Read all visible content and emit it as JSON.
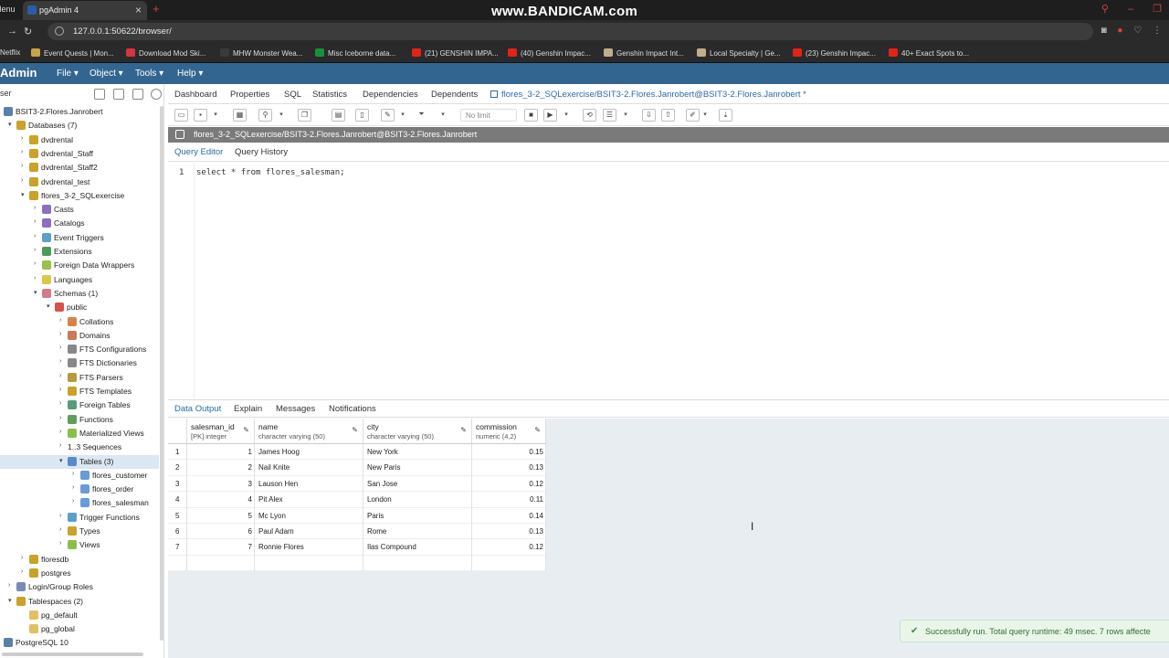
{
  "browser": {
    "menu_label": "Menu",
    "tab_title": "pgAdmin 4",
    "watermark": "www.BANDICAM.com",
    "url": "127.0.0.1:50622/browser/",
    "bookmarks": [
      {
        "label": "Netflix",
        "color": "#e50914"
      },
      {
        "label": "Event Quests | Mon...",
        "color": "#c8a44a"
      },
      {
        "label": "Download Mod Ski...",
        "color": "#d9343f"
      },
      {
        "label": "MHW Monster Wea...",
        "color": "#3a3a3a"
      },
      {
        "label": "Misc Iceborne data...",
        "color": "#1a8f3a"
      },
      {
        "label": "(21) GENSHIN IMPA...",
        "color": "#e62117"
      },
      {
        "label": "(40) Genshin Impac...",
        "color": "#e62117"
      },
      {
        "label": "Genshin Impact Int...",
        "color": "#bfae8a"
      },
      {
        "label": "Local Specialty | Ge...",
        "color": "#bfae8a"
      },
      {
        "label": "(23) Genshin Impac...",
        "color": "#e62117"
      },
      {
        "label": "40+ Exact Spots to...",
        "color": "#e62117"
      }
    ]
  },
  "pgadmin": {
    "brand": "Admin",
    "menus": [
      "File ▾",
      "Object ▾",
      "Tools ▾",
      "Help ▾"
    ]
  },
  "left_panel": {
    "title": "ser",
    "tree": [
      {
        "label": "BSIT3-2.Flores.Janrobert",
        "level": 0,
        "chev": "",
        "icon": "#5b7fa8"
      },
      {
        "label": "Databases (7)",
        "level": 1,
        "chev": "▾",
        "icon": "#c9a227"
      },
      {
        "label": "dvdrental",
        "level": 2,
        "chev": "›",
        "icon": "#c9a227"
      },
      {
        "label": "dvdrental_Staff",
        "level": 2,
        "chev": "›",
        "icon": "#c9a227"
      },
      {
        "label": "dvdrental_Staff2",
        "level": 2,
        "chev": "›",
        "icon": "#c9a227"
      },
      {
        "label": "dvdrental_test",
        "level": 2,
        "chev": "›",
        "icon": "#c9a227"
      },
      {
        "label": "flores_3-2_SQLexercise",
        "level": 2,
        "chev": "▾",
        "icon": "#c9a227"
      },
      {
        "label": "Casts",
        "level": 3,
        "chev": "›",
        "icon": "#8c6fbf"
      },
      {
        "label": "Catalogs",
        "level": 3,
        "chev": "›",
        "icon": "#8c6fbf"
      },
      {
        "label": "Event Triggers",
        "level": 3,
        "chev": "›",
        "icon": "#5aa0c8"
      },
      {
        "label": "Extensions",
        "level": 3,
        "chev": "›",
        "icon": "#4a9a5a"
      },
      {
        "label": "Foreign Data Wrappers",
        "level": 3,
        "chev": "›",
        "icon": "#9ac24a"
      },
      {
        "label": "Languages",
        "level": 3,
        "chev": "›",
        "icon": "#d9c84a"
      },
      {
        "label": "Schemas (1)",
        "level": 3,
        "chev": "▾",
        "icon": "#d47a8a"
      },
      {
        "label": "public",
        "level": 4,
        "chev": "▾",
        "icon": "#d4544a"
      },
      {
        "label": "Collations",
        "level": 5,
        "chev": "›",
        "icon": "#d4844a"
      },
      {
        "label": "Domains",
        "level": 5,
        "chev": "›",
        "icon": "#c87a5a"
      },
      {
        "label": "FTS Configurations",
        "level": 5,
        "chev": "›",
        "icon": "#888888"
      },
      {
        "label": "FTS Dictionaries",
        "level": 5,
        "chev": "›",
        "icon": "#888888"
      },
      {
        "label": "FTS Parsers",
        "level": 5,
        "chev": "›",
        "icon": "#b89a3a"
      },
      {
        "label": "FTS Templates",
        "level": 5,
        "chev": "›",
        "icon": "#c9a227"
      },
      {
        "label": "Foreign Tables",
        "level": 5,
        "chev": "›",
        "icon": "#5a9a7a"
      },
      {
        "label": "Functions",
        "level": 5,
        "chev": "›",
        "icon": "#5aa05a"
      },
      {
        "label": "Materialized Views",
        "level": 5,
        "chev": "›",
        "icon": "#8ac04a"
      },
      {
        "label": "1..3 Sequences",
        "level": 5,
        "chev": "›",
        "icon": ""
      },
      {
        "label": "Tables (3)",
        "level": 5,
        "chev": "▾",
        "icon": "#5a8ac8",
        "selected": true
      },
      {
        "label": "flores_customer",
        "level": 6,
        "chev": "›",
        "icon": "#6a9ad8"
      },
      {
        "label": "flores_order",
        "level": 6,
        "chev": "›",
        "icon": "#6a9ad8"
      },
      {
        "label": "flores_salesman",
        "level": 6,
        "chev": "›",
        "icon": "#6a9ad8"
      },
      {
        "label": "Trigger Functions",
        "level": 5,
        "chev": "›",
        "icon": "#5aa0c8"
      },
      {
        "label": "Types",
        "level": 5,
        "chev": "›",
        "icon": "#c9a227"
      },
      {
        "label": "Views",
        "level": 5,
        "chev": "›",
        "icon": "#8ac04a"
      },
      {
        "label": "floresdb",
        "level": 2,
        "chev": "›",
        "icon": "#c9a227"
      },
      {
        "label": "postgres",
        "level": 2,
        "chev": "›",
        "icon": "#c9a227"
      },
      {
        "label": "Login/Group Roles",
        "level": 1,
        "chev": "›",
        "icon": "#7a8ab8"
      },
      {
        "label": "Tablespaces (2)",
        "level": 1,
        "chev": "▾",
        "icon": "#c9a227"
      },
      {
        "label": "pg_default",
        "level": 2,
        "chev": "",
        "icon": "#e0c060"
      },
      {
        "label": "pg_global",
        "level": 2,
        "chev": "",
        "icon": "#e0c060"
      },
      {
        "label": "PostgreSQL 10",
        "level": 0,
        "chev": "",
        "icon": "#5b7fa8"
      }
    ]
  },
  "main_tabs": [
    "Dashboard",
    "Properties",
    "SQL",
    "Statistics",
    "Dependencies",
    "Dependents",
    "flores_3-2_SQLexercise/BSIT3-2.Flores.Janrobert@BSIT3-2.Flores.Janrobert *"
  ],
  "toolbar": {
    "limit_label": "No limit"
  },
  "connection_label": "flores_3-2_SQLexercise/BSIT3-2.Flores.Janrobert@BSIT3-2.Flores.Janrobert",
  "editor_tabs": [
    "Query Editor",
    "Query History"
  ],
  "editor": {
    "line_number": "1",
    "code": "select * from flores_salesman;"
  },
  "result_tabs": [
    "Data Output",
    "Explain",
    "Messages",
    "Notifications"
  ],
  "grid": {
    "columns": [
      {
        "name": "salesman_id",
        "type": "[PK] integer"
      },
      {
        "name": "name",
        "type": "character varying (50)"
      },
      {
        "name": "city",
        "type": "character varying (50)"
      },
      {
        "name": "commission",
        "type": "numeric (4,2)"
      }
    ],
    "rows": [
      {
        "n": "1",
        "id": "1",
        "name": "James Hoog",
        "city": "New York",
        "commission": "0.15"
      },
      {
        "n": "2",
        "id": "2",
        "name": "Nail Knite",
        "city": "New Paris",
        "commission": "0.13"
      },
      {
        "n": "3",
        "id": "3",
        "name": "Lauson Hen",
        "city": "San Jose",
        "commission": "0.12"
      },
      {
        "n": "4",
        "id": "4",
        "name": "Pit Alex",
        "city": "London",
        "commission": "0.11"
      },
      {
        "n": "5",
        "id": "5",
        "name": "Mc Lyon",
        "city": "Paris",
        "commission": "0.14"
      },
      {
        "n": "6",
        "id": "6",
        "name": "Paul Adam",
        "city": "Rome",
        "commission": "0.13"
      },
      {
        "n": "7",
        "id": "7",
        "name": "Ronnie Flores",
        "city": "Ilas Compound",
        "commission": "0.12"
      }
    ]
  },
  "status_message": "Successfully run. Total query runtime: 49 msec. 7 rows affecte"
}
